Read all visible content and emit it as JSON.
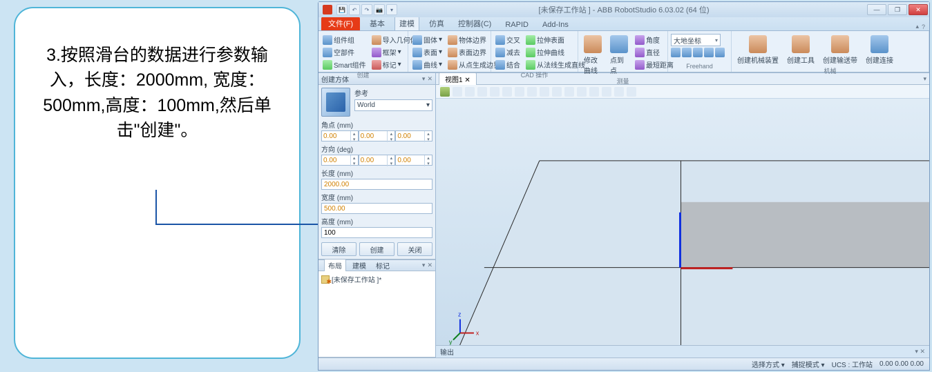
{
  "callout": {
    "text": "3.按照滑台的数据进行参数输入，长度：2000mm, 宽度：500mm,高度：100mm,然后单击\"创建\"。"
  },
  "titlebar": {
    "title": "[未保存工作站 ] - ABB RobotStudio 6.03.02 (64 位)"
  },
  "tabs": {
    "file": "文件(F)",
    "items": [
      "基本",
      "建模",
      "仿真",
      "控制器(C)",
      "RAPID",
      "Add-Ins"
    ],
    "activeIndex": 1
  },
  "ribbon": {
    "g1": {
      "items": [
        "组件组",
        "空部件",
        "Smart组件"
      ],
      "import": "导入几何体",
      "items2": [
        "框架",
        "标记"
      ],
      "label": "创建"
    },
    "g2": {
      "c1": [
        "固体",
        "表面",
        "曲线"
      ],
      "c2": [
        "物体边界",
        "表面边界",
        "从点生成边界"
      ]
    },
    "g3": {
      "c1": [
        "交叉",
        "减去",
        "结合"
      ],
      "c2": [
        "拉伸表面",
        "拉伸曲线",
        "从法线生成直线"
      ],
      "label": "CAD 操作"
    },
    "g4": {
      "big": "修改曲线",
      "big2": "点到点",
      "c": [
        "角度",
        "直径",
        "最短距离"
      ],
      "label": "测量"
    },
    "g5": {
      "combo": "大地坐标",
      "label": "Freehand"
    },
    "g6": {
      "items": [
        "创建机械装置",
        "创建工具",
        "创建输送带",
        "创建连接"
      ],
      "label": "机械"
    }
  },
  "left": {
    "create": {
      "title": "创建方体",
      "ref_label": "参考",
      "world": "World",
      "corner_label": "角点 (mm)",
      "corner": [
        "0.00",
        "0.00",
        "0.00"
      ],
      "orient_label": "方向 (deg)",
      "orient": [
        "0.00",
        "0.00",
        "0.00"
      ],
      "length_label": "长度 (mm)",
      "length": "2000.00",
      "width_label": "宽度 (mm)",
      "width": "500.00",
      "height_label": "高度 (mm)",
      "height": "100",
      "btn_clear": "清除",
      "btn_create": "创建",
      "btn_close": "关闭"
    },
    "layout_tabs": [
      "布局",
      "建模",
      "标记"
    ],
    "layout_active": 0,
    "tree_item": "[未保存工作站 ]*"
  },
  "view": {
    "tab": "视图1",
    "output": "输出"
  },
  "status": {
    "s1": "选择方式",
    "s2": "捕捉模式",
    "s3": "UCS : 工作站",
    "coords": "0.00  0.00  0.00"
  }
}
